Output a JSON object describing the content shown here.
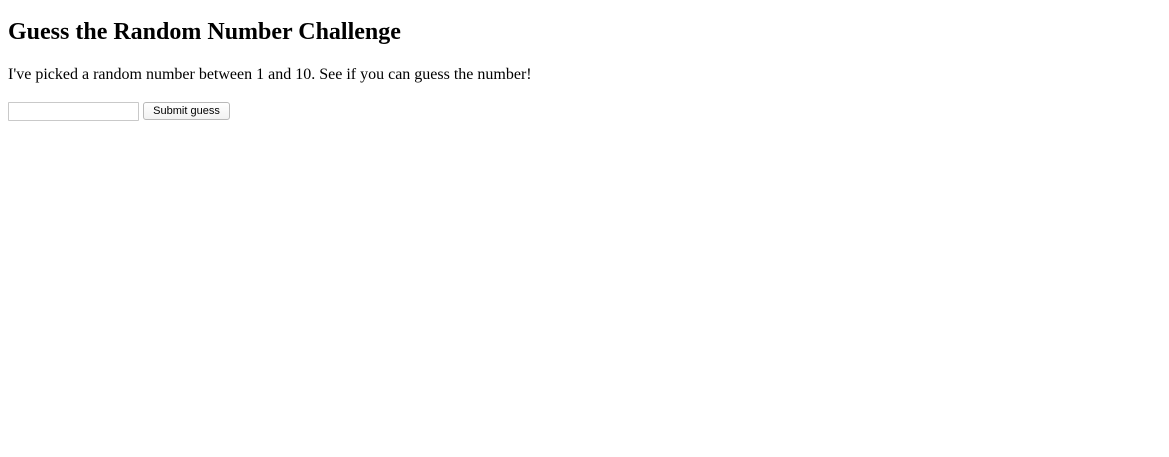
{
  "header": {
    "title": "Guess the Random Number Challenge"
  },
  "main": {
    "intro_text": "I've picked a random number between 1 and 10. See if you can guess the number!",
    "guess_form": {
      "input_value": "",
      "submit_label": "Submit guess"
    }
  }
}
